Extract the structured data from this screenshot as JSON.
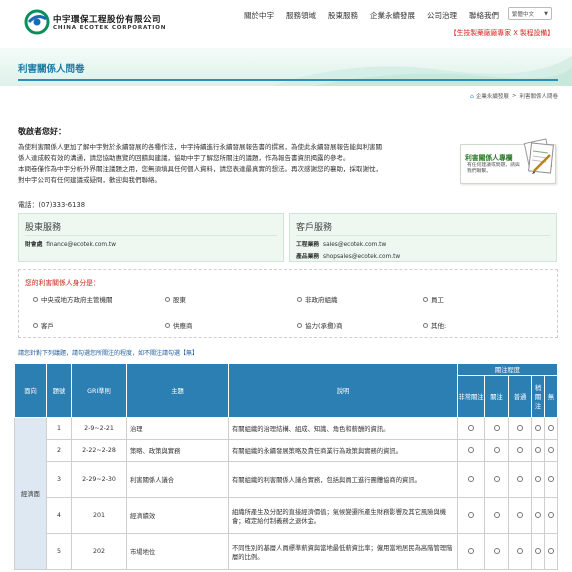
{
  "header": {
    "logo_cn": "中宇環保工程股份有限公司",
    "logo_en": "CHINA ECOTEK CORPORATION",
    "nav": [
      "關於中宇",
      "服務領域",
      "股東服務",
      "企業永續發展",
      "公司治理",
      "聯絡我們"
    ],
    "language": "繁體中文",
    "slogan": "【生技製藥廠廠專家 X 製程設備】"
  },
  "banner": {
    "title": "利害關係人問卷"
  },
  "breadcrumb": {
    "items": [
      "企業永續發展",
      "利害關係人問卷"
    ],
    "separator": ">"
  },
  "greeting": "敬啟者您好：",
  "intro_lines": [
    "為使利害關係人更加了解中宇對於永續發展的各種作法，中宇持續進行永續發展報告書的撰寫，為使此永續發展報告能與利害關",
    "係人達成較有效的溝通，請您協助惠覽的回饋與建議，協助中宇了解您所關注的議題，作為報告書資訊揭露的參考。",
    "本問卷僅作為中宇分析外界關注議題之用，您無須填具任何個人資料，請您表達最真實的想法。再次感謝您的襄助，採取謝忱，",
    "對中宇公司有任何建議或疑問，歡迎與我們聯絡。"
  ],
  "phone": "電話：(07)333-6138",
  "survey_card": {
    "title": "利害關係人專欄",
    "subtitle": "有任何建議或問題，請與我們聯繫。"
  },
  "contacts": [
    {
      "title": "股東服務",
      "lines": [
        {
          "label": "財會處",
          "value": "finance@ecotek.com.tw"
        }
      ]
    },
    {
      "title": "客戶服務",
      "lines": [
        {
          "label": "工程業務",
          "value": "sales@ecotek.com.tw"
        },
        {
          "label": "產品業務",
          "value": "shopsales@ecotek.com.tw"
        }
      ]
    }
  ],
  "identity": {
    "title": "您的利害關係人身分是：",
    "options": [
      "中央或地方政府主管機關",
      "股東",
      "非政府組織",
      "員工",
      "客戶",
      "供應商",
      "協力(承攬)商",
      "其他:"
    ]
  },
  "instruction": "請您針對下列議題，請勾選您所關注的程度，如不關注請勾選【無】",
  "table": {
    "headers": {
      "aspect": "面向",
      "no": "題號",
      "gri": "GRI準則",
      "topic": "主題",
      "desc": "說明",
      "concern": "關注程度",
      "levels": [
        "非常關注",
        "關注",
        "普通",
        "稍關注",
        "無"
      ]
    },
    "aspect_label": "經濟面",
    "rows": [
      {
        "no": "1",
        "gri": "2-9~2-21",
        "topic": "治理",
        "desc": "有關組織的治理結構、組成、知識、角色和薪酬的資訊。"
      },
      {
        "no": "2",
        "gri": "2-22~2-28",
        "topic": "策略、政策與實務",
        "desc": "有關組織的永續發展策略及責任商業行為政策與實務的資訊。"
      },
      {
        "no": "3",
        "gri": "2-29~2-30",
        "topic": "利害關係人議合",
        "desc": "有關組織的利害關係人議合實務，包括與員工進行團體協商的資訊。"
      },
      {
        "no": "4",
        "gri": "201",
        "topic": "經濟績效",
        "desc": "組織所產生及分配的直接經濟價值；氣候變遷所產生財務影響及其它風險與機會；確定給付制義務之退休金。"
      },
      {
        "no": "5",
        "gri": "202",
        "topic": "市場地位",
        "desc": "不同性別的基層人員標準薪資與當地最低薪資比率；僱用當地居民為高階管理階層的比例。"
      }
    ]
  },
  "colors": {
    "accent": "#2b7fb3",
    "slogan": "#d6201b",
    "banner_line": "#2d8fb5"
  },
  "icons": [
    "logo-mark-icon",
    "home-icon",
    "survey-document-icon",
    "chevron-down-icon"
  ]
}
